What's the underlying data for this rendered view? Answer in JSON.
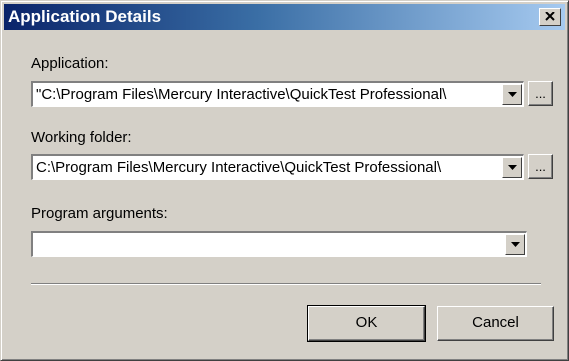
{
  "dialog": {
    "title": "Application Details",
    "close_icon": "close-icon"
  },
  "application": {
    "label": "Application:",
    "value": "\"C:\\Program Files\\Mercury Interactive\\QuickTest Professional\\",
    "browse_label": "..."
  },
  "working_folder": {
    "label": "Working folder:",
    "value": "C:\\Program Files\\Mercury Interactive\\QuickTest Professional\\",
    "browse_label": "..."
  },
  "program_arguments": {
    "label": "Program arguments:",
    "value": ""
  },
  "buttons": {
    "ok": "OK",
    "cancel": "Cancel"
  },
  "colors": {
    "titlebar_start": "#0a246a",
    "titlebar_end": "#a6caf0",
    "face": "#d4d0c8"
  }
}
